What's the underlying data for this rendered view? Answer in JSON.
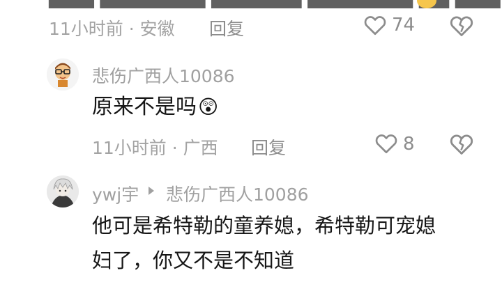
{
  "top_comment": {
    "meta": "11小时前 · 安徽",
    "reply_label": "回复",
    "likes": "74"
  },
  "reply1": {
    "username": "悲伤广西人10086",
    "text": "原来不是吗",
    "emoji": "😲",
    "meta": "11小时前 · 广西",
    "reply_label": "回复",
    "likes": "8"
  },
  "reply2": {
    "username": "ywj宇",
    "reply_to": "悲伤广西人10086",
    "text_line1": "他可是希特勒的童养媳，希特勒可宠媳",
    "text_line2": "妇了，你又不是不知道"
  },
  "colors": {
    "meta_gray": "#a3a3a3",
    "text_dark": "#161616",
    "icon_gray": "#8c8c8c"
  }
}
